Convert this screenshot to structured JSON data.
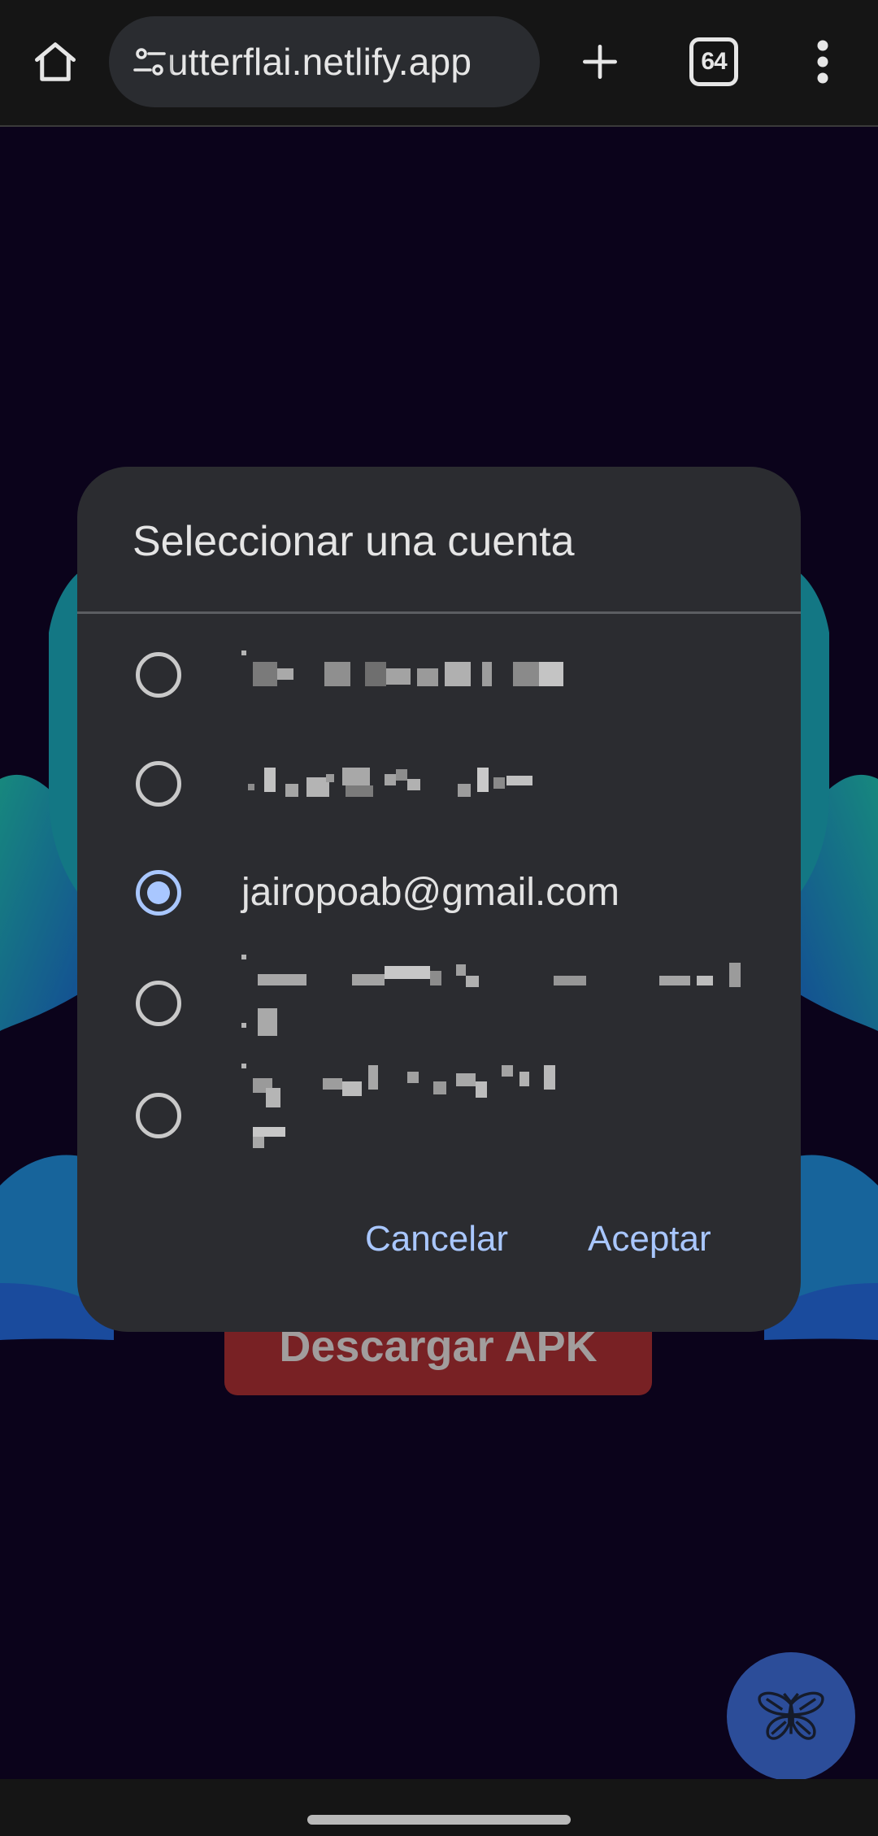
{
  "browser": {
    "url": "utterflai.netlify.app",
    "tab_count": "64",
    "icons": {
      "home": "home-icon",
      "site_settings": "tune-icon",
      "new_tab": "plus-icon",
      "tabs": "tab-switcher-icon",
      "menu": "more-vert-icon"
    }
  },
  "page": {
    "download_button": "Descargar APK",
    "fab_icon": "butterfly-icon"
  },
  "dialog": {
    "title": "Seleccionar una cuenta",
    "accounts": [
      {
        "email": "",
        "redacted": true,
        "selected": false
      },
      {
        "email": "",
        "redacted": true,
        "selected": false
      },
      {
        "email": "jairopoab@gmail.com",
        "redacted": false,
        "selected": true
      },
      {
        "email": "",
        "redacted": true,
        "selected": false
      },
      {
        "email": "",
        "redacted": true,
        "selected": false
      }
    ],
    "cancel_label": "Cancelar",
    "accept_label": "Aceptar"
  },
  "colors": {
    "page_background": "#0f0424",
    "dialog_background": "#2b2c30",
    "accent": "#a9c7ff",
    "download_button": "#a02d30",
    "fab": "#3b67cc"
  }
}
